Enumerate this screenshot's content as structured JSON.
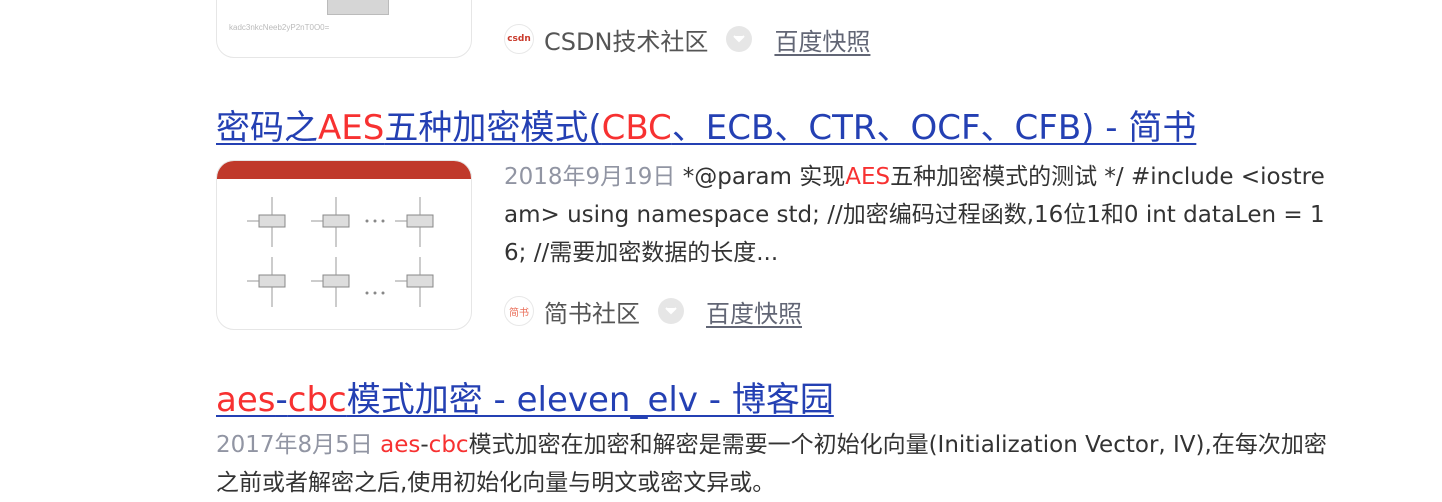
{
  "result_top": {
    "source_icon_text": "csdn",
    "source_name": "CSDN技术社区",
    "cache_label": "百度快照",
    "thumb_caption": "kadc3nkcNeeb2yP2nT0O0="
  },
  "result_aes_modes": {
    "title_part1": "密码之",
    "title_em1": "AES",
    "title_part2": "五种加密模式(",
    "title_em2": "CBC",
    "title_part3": "、ECB、CTR、OCF、CFB) - 简书",
    "date": "2018年9月19日",
    "snippet_part1": " *@param 实现",
    "snippet_em": "AES",
    "snippet_part2": "五种加密模式的测试 */ #include <iostream> using namespace std; //加密编码过程函数,16位1和0 int dataLen = 16; //需要加密数据的长度...",
    "source_icon_text": "简书",
    "source_name": "简书社区",
    "cache_label": "百度快照"
  },
  "result_aes_cbc": {
    "title_em1": "aes",
    "title_dash": "-",
    "title_em2": "cbc",
    "title_rest": "模式加密 - eleven_elv - 博客园",
    "date": "2017年8月5日",
    "snippet_em1": "aes",
    "snippet_dash": "-",
    "snippet_em2": "cbc",
    "snippet_rest": "模式加密在加密和解密是需要一个初始化向量(Initialization Vector, IV),在每次加密之前或者解密之后,使用初始化向量与明文或密文异或。"
  },
  "colors": {
    "link": "#2440b3",
    "highlight": "#f73131",
    "date": "#9195a3",
    "text": "#333333"
  }
}
